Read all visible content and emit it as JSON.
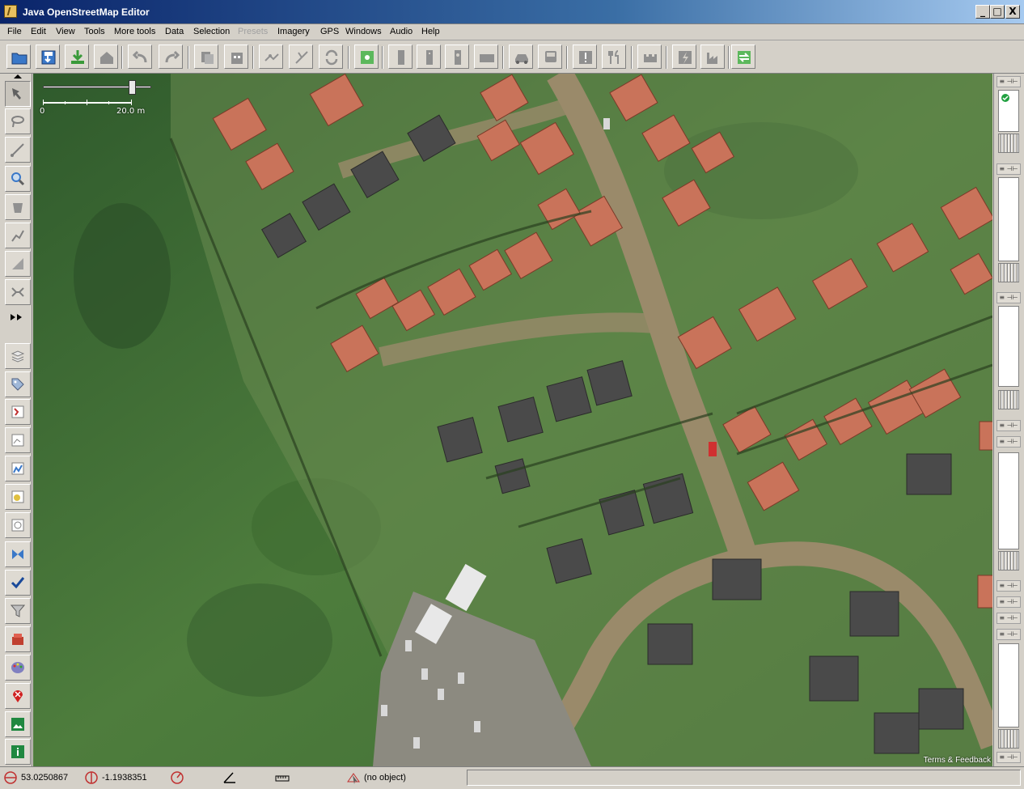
{
  "window": {
    "title": "Java OpenStreetMap Editor",
    "buttons": {
      "minimize": "_",
      "maximize": "□",
      "close": "X"
    }
  },
  "menu": [
    {
      "label": "File",
      "enabled": true
    },
    {
      "label": "Edit",
      "enabled": true
    },
    {
      "label": "View",
      "enabled": true
    },
    {
      "label": "Tools",
      "enabled": true
    },
    {
      "label": "More tools",
      "enabled": true
    },
    {
      "label": "Data",
      "enabled": true
    },
    {
      "label": "Selection",
      "enabled": true
    },
    {
      "label": "Presets",
      "enabled": false
    },
    {
      "label": "Imagery",
      "enabled": true
    },
    {
      "label": "GPS",
      "enabled": true
    },
    {
      "label": "Windows",
      "enabled": true
    },
    {
      "label": "Audio",
      "enabled": true
    },
    {
      "label": "Help",
      "enabled": true
    }
  ],
  "toolbar": {
    "buttons": [
      {
        "name": "open-file",
        "icon": "folder-icon",
        "color": "#3a78c8"
      },
      {
        "name": "save",
        "icon": "save-icon",
        "color": "#3a78c8"
      },
      {
        "name": "download",
        "icon": "download-icon",
        "color": "#3a9a3a"
      },
      {
        "name": "upload",
        "icon": "upload-icon",
        "color": "#909090"
      },
      {
        "name": "undo",
        "icon": "undo-icon",
        "color": "#909090"
      },
      {
        "name": "redo",
        "icon": "redo-icon",
        "color": "#909090"
      },
      {
        "name": "copy",
        "icon": "copy-icon",
        "color": "#909090"
      },
      {
        "name": "paste",
        "icon": "paste-icon",
        "color": "#909090"
      },
      {
        "name": "split-way",
        "icon": "split-icon",
        "color": "#909090"
      },
      {
        "name": "combine-way",
        "icon": "combine-icon",
        "color": "#909090"
      },
      {
        "name": "reverse-way",
        "icon": "reverse-icon",
        "color": "#909090"
      },
      {
        "name": "zoom-to-data",
        "icon": "zoom-data-icon",
        "color": "#3a9a3a"
      },
      {
        "name": "preset-1",
        "icon": "preset-icon",
        "color": "#909090"
      },
      {
        "name": "preset-2",
        "icon": "preset-icon",
        "color": "#909090"
      },
      {
        "name": "preset-3",
        "icon": "preset-icon",
        "color": "#909090"
      },
      {
        "name": "preset-4",
        "icon": "preset-icon",
        "color": "#909090"
      },
      {
        "name": "car",
        "icon": "car-icon",
        "color": "#909090"
      },
      {
        "name": "bus",
        "icon": "bus-icon",
        "color": "#909090"
      },
      {
        "name": "hazard",
        "icon": "exclamation-icon",
        "color": "#909090"
      },
      {
        "name": "restaurant",
        "icon": "cutlery-icon",
        "color": "#909090"
      },
      {
        "name": "castle",
        "icon": "castle-icon",
        "color": "#909090"
      },
      {
        "name": "power",
        "icon": "lightning-icon",
        "color": "#909090"
      },
      {
        "name": "industrial",
        "icon": "factory-icon",
        "color": "#909090"
      },
      {
        "name": "move",
        "icon": "move-icon",
        "color": "#3a9a3a"
      }
    ]
  },
  "left_tools": [
    {
      "name": "select",
      "icon": "select-icon",
      "active": true
    },
    {
      "name": "lasso",
      "icon": "lasso-icon",
      "active": false
    },
    {
      "name": "draw",
      "icon": "draw-icon",
      "active": false
    },
    {
      "name": "zoom",
      "icon": "zoom-icon",
      "active": false
    },
    {
      "name": "delete",
      "icon": "delete-icon",
      "active": false
    },
    {
      "name": "parallel",
      "icon": "parallel-icon",
      "active": false
    },
    {
      "name": "improve-way",
      "icon": "improve-way-icon",
      "active": false
    },
    {
      "name": "extrude",
      "icon": "extrude-icon",
      "active": false
    },
    {
      "name": "more",
      "icon": "double-arrow-icon",
      "active": false
    },
    {
      "name": "layers",
      "icon": "layers-icon",
      "active": false
    },
    {
      "name": "tags",
      "icon": "tag-icon",
      "active": false
    },
    {
      "name": "relations",
      "icon": "relations-icon",
      "active": false
    },
    {
      "name": "selection-list",
      "icon": "selection-list-icon",
      "active": false
    },
    {
      "name": "authors",
      "icon": "authors-icon",
      "active": false
    },
    {
      "name": "commands",
      "icon": "commands-icon",
      "active": false
    },
    {
      "name": "changesets",
      "icon": "changesets-icon",
      "active": false
    },
    {
      "name": "conflicts",
      "icon": "conflict-icon",
      "active": false
    },
    {
      "name": "validator",
      "icon": "checkmark-icon",
      "active": false
    },
    {
      "name": "filter",
      "icon": "filter-icon",
      "active": false
    },
    {
      "name": "toggle-dialog",
      "icon": "box-icon",
      "active": false
    },
    {
      "name": "map-paint",
      "icon": "palette-icon",
      "active": false
    },
    {
      "name": "notes",
      "icon": "pin-icon",
      "active": false
    },
    {
      "name": "image",
      "icon": "image-icon",
      "active": false
    },
    {
      "name": "info",
      "icon": "info-icon",
      "active": false
    }
  ],
  "map": {
    "scale": {
      "left_label": "0",
      "right_label": "20.0 m"
    },
    "attribution": "Terms & Feedback",
    "colors": {
      "grass": "#4d7a3c",
      "road": "#9a8a6a",
      "roof_red": "#c9735a",
      "roof_grey": "#4a4a4a"
    }
  },
  "statusbar": {
    "latitude": "53.0250867",
    "longitude": "-1.1938351",
    "object": "(no object)"
  }
}
